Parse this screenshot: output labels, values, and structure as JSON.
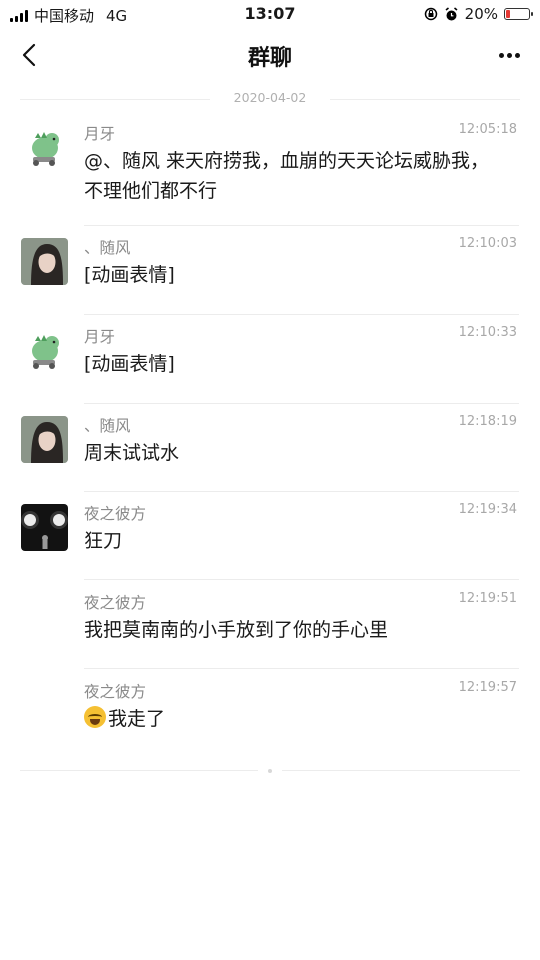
{
  "status_bar": {
    "carrier": "中国移动",
    "network": "4G",
    "time": "13:07",
    "battery_percent": "20%",
    "battery_level": 0.2
  },
  "nav": {
    "title": "群聊"
  },
  "date_divider": "2020-04-02",
  "messages": [
    {
      "name": "月牙",
      "time": "12:05:18",
      "text": "@、随风 来天府捞我，血崩的天天论坛威胁我，不理他们都不行",
      "avatar": "dinosaur-avatar"
    },
    {
      "name": "、随风",
      "time": "12:10:03",
      "text": "[动画表情]",
      "avatar": "girl-photo-avatar"
    },
    {
      "name": "月牙",
      "time": "12:10:33",
      "text": "[动画表情]",
      "avatar": "dinosaur-avatar"
    },
    {
      "name": "、随风",
      "time": "12:18:19",
      "text": "周末试试水",
      "avatar": "girl-photo-avatar"
    },
    {
      "name": "夜之彼方",
      "time": "12:19:34",
      "text": "狂刀",
      "avatar": "dark-night-avatar"
    },
    {
      "name": "夜之彼方",
      "time": "12:19:51",
      "text": "我把莫南南的小手放到了你的手心里",
      "avatar": ""
    },
    {
      "name": "夜之彼方",
      "time": "12:19:57",
      "text": "我走了",
      "avatar": "",
      "emoji": "crying-face-emoji"
    }
  ]
}
